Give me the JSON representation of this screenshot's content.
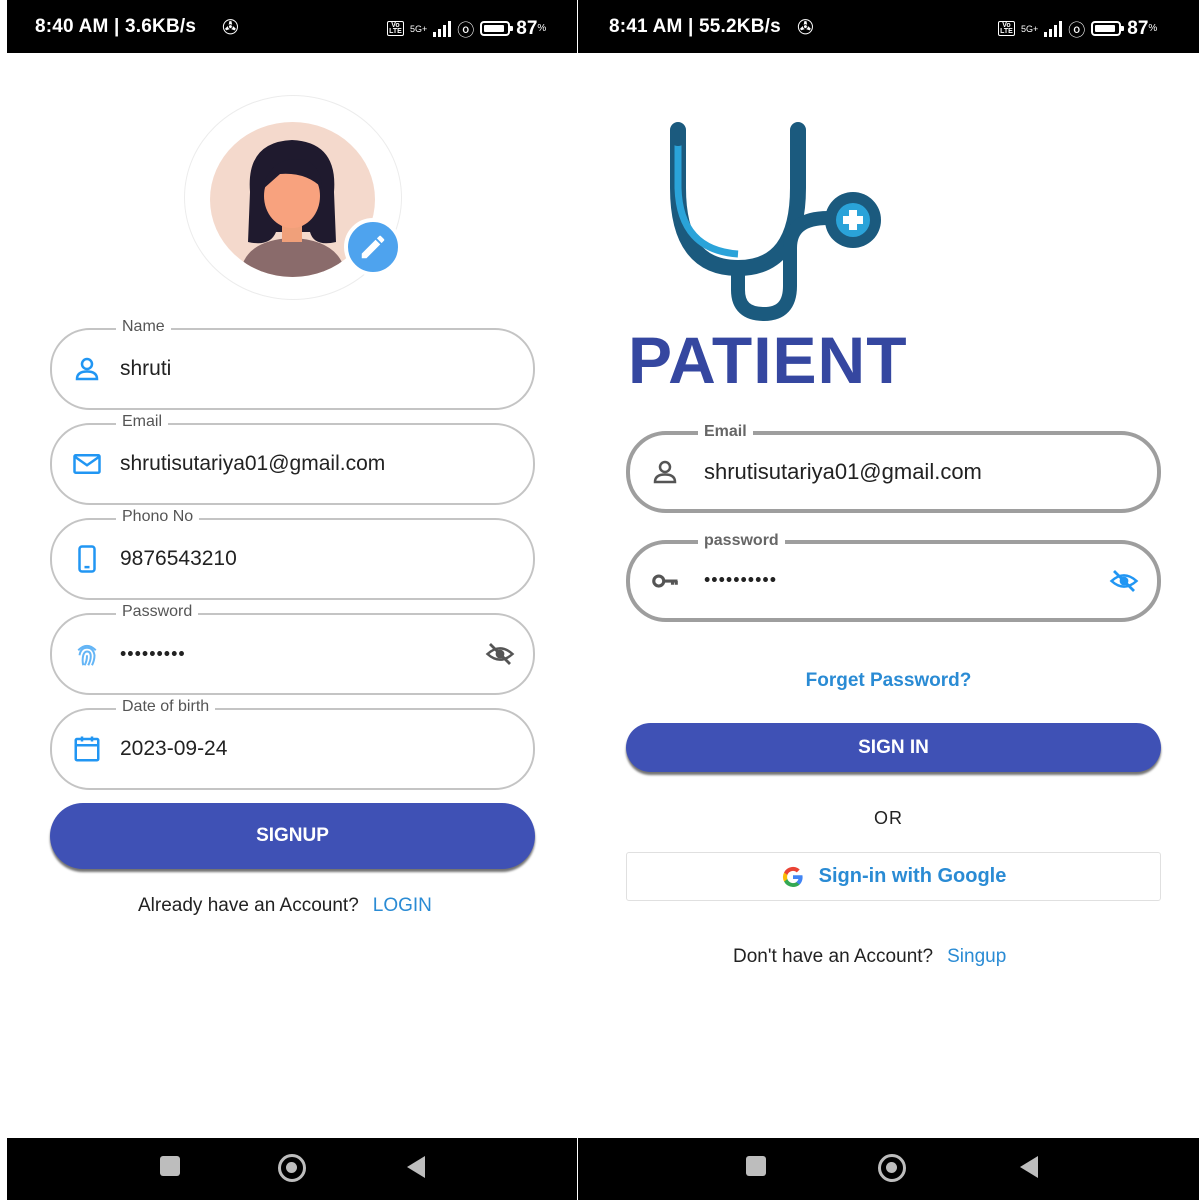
{
  "left_screen": {
    "status": {
      "time": "8:40 AM | 3.6KB/s",
      "network": "5G+",
      "battery": "87"
    },
    "fields": [
      {
        "label": "Name",
        "value": "shruti",
        "icon": "person-icon"
      },
      {
        "label": "Email",
        "value": "shrutisutariya01@gmail.com",
        "icon": "mail-icon"
      },
      {
        "label": "Phono No",
        "value": "9876543210",
        "icon": "phone-icon"
      },
      {
        "label": "Password",
        "value": "•••••••••",
        "icon": "fingerprint-icon"
      },
      {
        "label": "Date of birth",
        "value": "2023-09-24",
        "icon": "calendar-icon"
      }
    ],
    "signup_label": "SIGNUP",
    "footer_text": "Already have an Account?",
    "footer_link": "LOGIN"
  },
  "right_screen": {
    "status": {
      "time": "8:41 AM | 55.2KB/s",
      "network": "5G+",
      "battery": "87"
    },
    "logo_text": "PATIENT",
    "email_label": "Email",
    "email_value": "shrutisutariya01@gmail.com",
    "password_label": "password",
    "password_value": "••••••••••",
    "forgot_label": "Forget Password?",
    "signin_label": "SIGN IN",
    "or_label": "OR",
    "google_label": "Sign-in with Google",
    "footer_text": "Don't have an Account?",
    "footer_link": "Singup"
  },
  "colors": {
    "primary": "#3f51b5",
    "link": "#2a8bd4",
    "icon_blue": "#2196f3",
    "logo_dark": "#1b5a7e"
  }
}
